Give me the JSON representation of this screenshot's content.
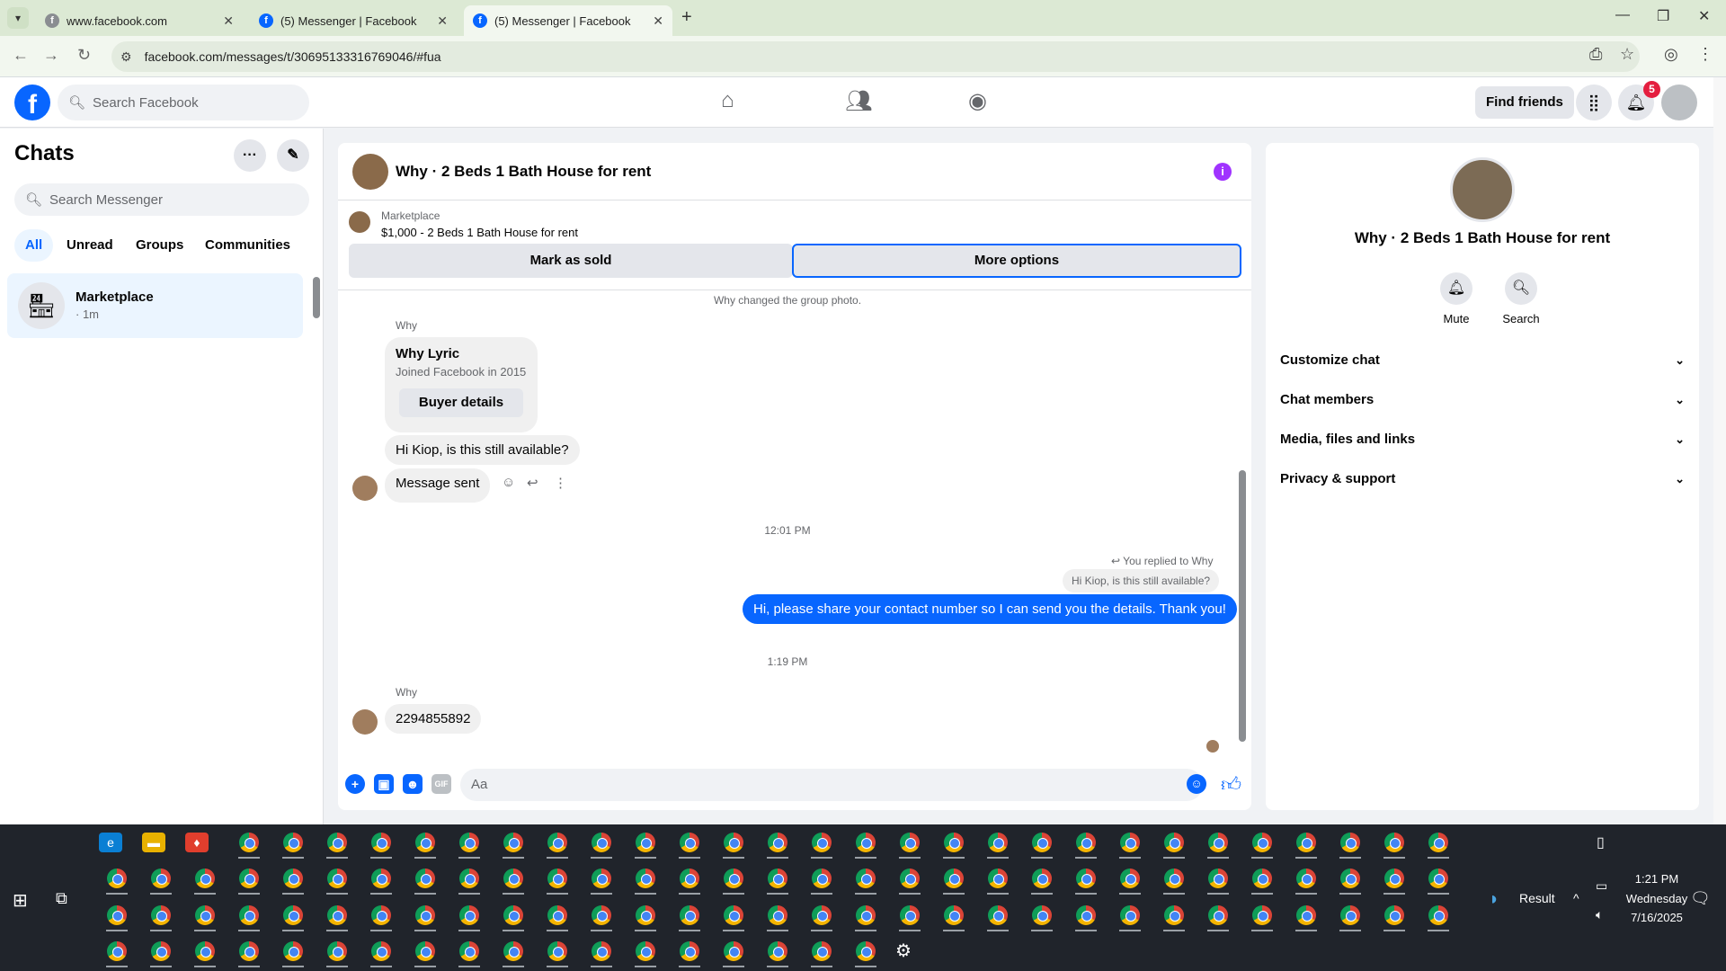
{
  "browser": {
    "tabs": [
      {
        "title": "www.facebook.com",
        "active": false
      },
      {
        "title": "(5) Messenger | Facebook",
        "active": false
      },
      {
        "title": "(5) Messenger | Facebook",
        "active": true
      }
    ],
    "url": "facebook.com/messages/t/30695133316769046/#fua"
  },
  "header": {
    "search_placeholder": "Search Facebook",
    "find_friends": "Find friends",
    "notif_count": "5"
  },
  "sidebar": {
    "title": "Chats",
    "search_placeholder": "Search Messenger",
    "filters": [
      "All",
      "Unread",
      "Groups",
      "Communities"
    ],
    "chat": {
      "name": "Marketplace",
      "time": "· 1m"
    }
  },
  "thread": {
    "title": "Why · 2 Beds 1 Bath House for rent",
    "listing": {
      "source": "Marketplace",
      "title": "$1,000 - 2 Beds 1 Bath House for rent"
    },
    "mark_sold": "Mark as sold",
    "more_options": "More options",
    "system_note": "Why changed the group photo.",
    "sender": "Why",
    "card": {
      "name": "Why Lyric",
      "subtitle": "Joined Facebook in 2015",
      "button": "Buyer details"
    },
    "msg_available": "Hi Kiop, is this still available?",
    "msg_sent": "Message sent",
    "time1": "12:01 PM",
    "reply_note": "You replied to Why",
    "quoted": "Hi Kiop, is this still available?",
    "outgoing": "Hi, please share your contact number so I can send you the details. Thank you!",
    "time2": "1:19 PM",
    "sender2": "Why",
    "phone": "2294855892",
    "composer_placeholder": "Aa"
  },
  "info_panel": {
    "title": "Why · 2 Beds 1 Bath House for rent",
    "actions": [
      "Mute",
      "Search"
    ],
    "sections": [
      "Customize chat",
      "Chat members",
      "Media, files and links",
      "Privacy & support"
    ]
  },
  "taskbar": {
    "result_label": "Result",
    "time": "1:21 PM",
    "day": "Wednesday",
    "date": "7/16/2025"
  }
}
